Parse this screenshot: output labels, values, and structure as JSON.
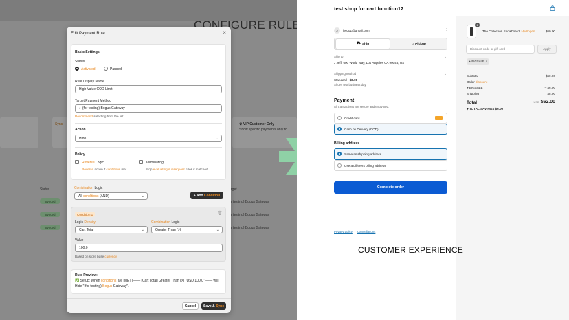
{
  "labels": {
    "configure_rule": "CONFIGURE RULE",
    "customer_experience": "CUSTOMER EXPERIENCE"
  },
  "background_admin": {
    "status_header": "Status",
    "target_header": "rget",
    "status_pills": [
      "Synced",
      "Synced",
      "Synced"
    ],
    "gateway_rows": [
      "r testing) Bogus Gateway",
      "r testing) Bogus Gateway",
      "r testing) Bogus Gateway"
    ],
    "vip_title": "VIP Customer Only",
    "vip_desc": "Show specific payments only to",
    "sync_card_prefix": "Sync"
  },
  "modal": {
    "title": "Edit Payment Rule",
    "close_glyph": "×",
    "basic_settings": "Basic Settings",
    "status_label": "Status",
    "status_activated": "Activated",
    "status_paused": "Paused",
    "display_name_label": "Rule Display Name",
    "display_name_value": "High Value COD Limit",
    "target_label": "Target Payment Method",
    "target_value": "(for testing) Bogus Gateway",
    "recommend_hint": "selecting from the list",
    "recommend_word": "Recommend",
    "action_label": "Action",
    "action_value": "Hide",
    "policy_label": "Policy",
    "reverse_logic": "Logic",
    "reverse_word": "Reverse",
    "reverse_hint_a": "action if",
    "reverse_hint_word": "Reverse",
    "reverse_hint_cond": "conditions",
    "reverse_hint_b": "met",
    "terminating": "Terminating",
    "terminating_hint_a": "Stop",
    "terminating_hint_word": "evaluating subsequent",
    "terminating_hint_b": "rules if matched",
    "combination_word": "Combination",
    "combination_logic": "Logic",
    "all_conditions_a": "All",
    "all_conditions_word": "conditions",
    "all_conditions_b": "(AND)",
    "add_condition_a": "+ Add",
    "add_condition_word": "Condition",
    "condition_badge": "Condition 1",
    "logic_word": "Logic",
    "logic_density": "Density",
    "cond_combination_word": "Combination",
    "cond_logic": "Logic",
    "cart_total": "Cart Total",
    "greater_than": "Greater Than (>)",
    "value_label": "Value",
    "value_value": "100.0",
    "based_on_a": "Based on store base",
    "based_on_word": "currency",
    "rule_preview_label": "Rule Preview:",
    "rule_preview_a": "✅ Setup: When",
    "rule_preview_word1": "conditions",
    "rule_preview_b": "are [MET] —— [Cart Total] Greater Than (>) \"USD 100.0\" ——",
    "rule_preview_c": "will Hide \"(for testing)",
    "rule_preview_word2": "Bogus",
    "rule_preview_d": "Gateway\".",
    "cancel": "Cancel",
    "save_a": "Save &",
    "save_word": "Sync"
  },
  "checkout": {
    "shop_name": "test shop for cart function12",
    "avatar_letter": "J",
    "email": "liwd01@gmail.com",
    "ship_tab": "Ship",
    "pickup_tab": "Pickup",
    "ship_to_label": "Ship to",
    "ship_to_value": "J Jeff, 600 World Way, Los Angeles CA 90045, US",
    "shipping_method_label": "Shipping method",
    "shipping_method_a": "Standard ·",
    "shipping_method_price": "$8.00",
    "shipping_method_desc": "Shoes test business day",
    "payment_title": "Payment",
    "payment_sub": "All transactions are secure and encrypted.",
    "credit_card": "Credit card",
    "cod": "Cash on Delivery (COD)",
    "billing_title": "Billing address",
    "same_as_shipping": "Same as shipping address",
    "different_billing": "Use a different billing address",
    "complete_order": "Complete order",
    "privacy": "Privacy policy",
    "cancellations": "Cancellations"
  },
  "summary": {
    "qty": "1",
    "product_a": "The Collection Snowboard:",
    "product_word": "Hydrogen",
    "product_price": "$60.00",
    "discount_placeholder": "Discount code or gift card",
    "apply": "Apply",
    "tag": "BIGSALE",
    "tag_close": "×",
    "subtotal_label": "Subtotal",
    "subtotal_value": "$60.00",
    "order_discount_a": "Order",
    "order_discount_word": "discount",
    "code_label": "BIGSALE",
    "code_value": "– $6.00",
    "shipping_label": "Shipping",
    "shipping_value": "$8.00",
    "total_label": "Total",
    "total_currency": "USD",
    "total_value": "$62.00",
    "savings_label": "TOTAL SAVINGS",
    "savings_value": "$6.00"
  },
  "colors": {
    "accent_orange": "#e8871e",
    "checkout_blue": "#0b5bd3",
    "arrow_green": "#8fd1a6"
  },
  "icons": [
    "close-icon",
    "chevron-down-icon",
    "trash-icon",
    "truck-icon",
    "store-icon",
    "tag-icon",
    "bag-icon",
    "more-icon",
    "right-arrow-icon"
  ]
}
